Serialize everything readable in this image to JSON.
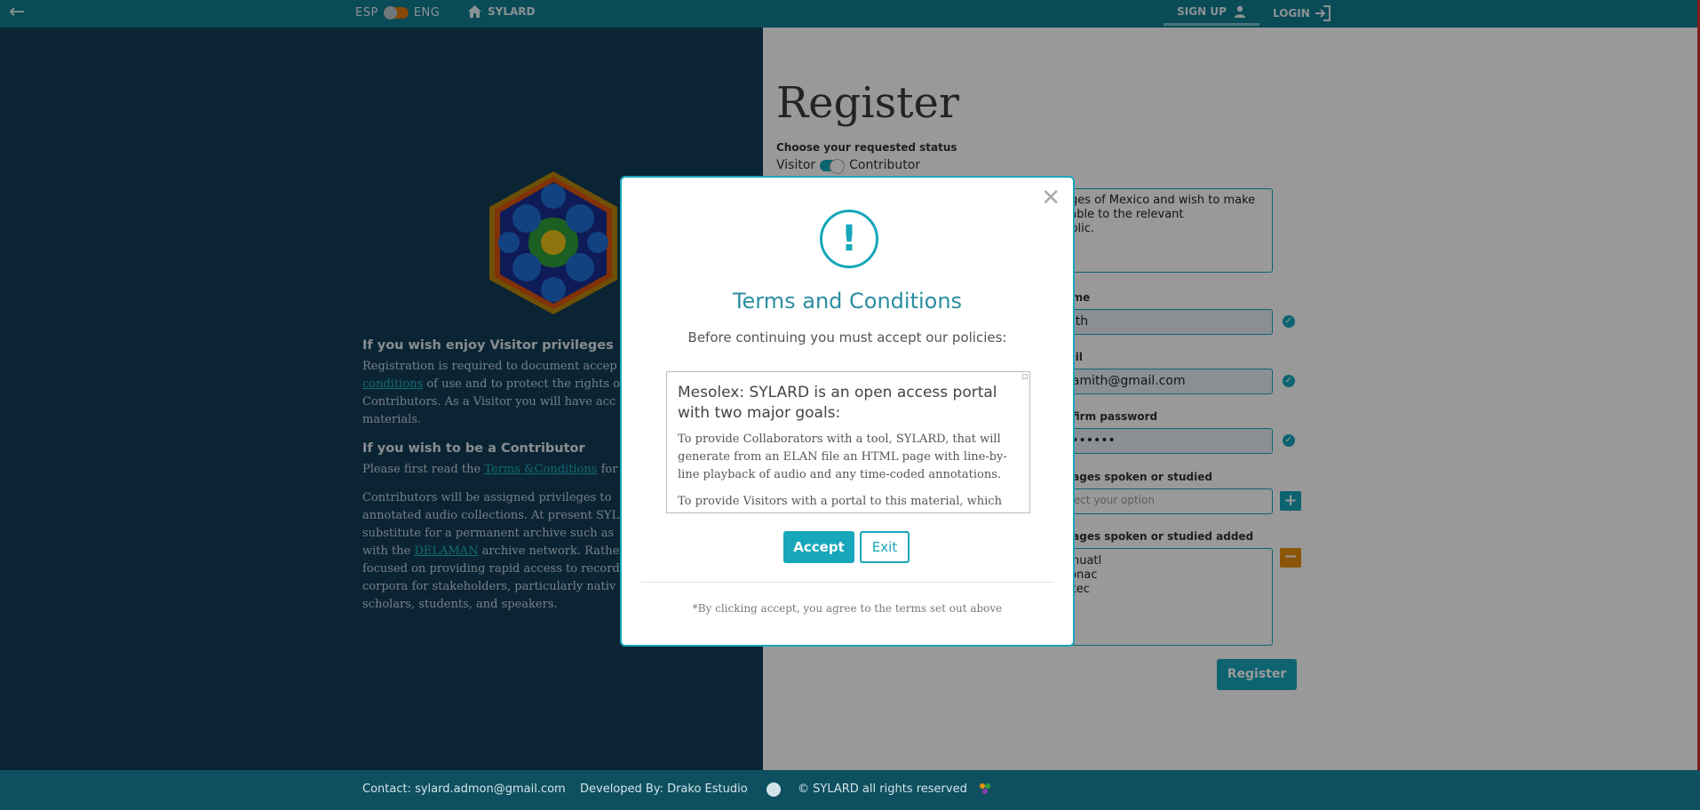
{
  "topbar": {
    "back_icon": "arrow-left-icon",
    "lang_left": "ESP",
    "lang_right": "ENG",
    "home_label": "SYLARD",
    "signup_label": "SIGN UP",
    "login_label": "LOGIN"
  },
  "left": {
    "visitor_heading": "If you wish enjoy Visitor privileges",
    "visitor_line1": "Registration is required to document accep",
    "visitor_link": "conditions",
    "visitor_line2_rest": " of use and to protect the rights o",
    "visitor_line3": "Contributors. As a Visitor you will have acc",
    "visitor_line4": "materials.",
    "contrib_heading": "If you wish to be a Contributor",
    "contrib_line1_pre": "Please first read the ",
    "contrib_link": "Terms &Conditions",
    "contrib_line1_post": " for",
    "para_line1": "Contributors will be assigned privileges to",
    "para_line2": "annotated audio collections. At present SYL",
    "para_line3": "substitute for a permanent archive such as",
    "para_line4_pre": "with the ",
    "para_line4_link": "DELAMAN",
    "para_line4_post": " archive network. Rather",
    "para_line5": "focused on providing rapid access to record",
    "para_line6": "corpora for stakeholders, particularly nativ",
    "para_line7": "scholars, students, and speakers."
  },
  "form": {
    "title": "Register",
    "status_label": "Choose your requested status",
    "status_left": "Visitor",
    "status_right": "Contributor",
    "textarea_lines": [
      "ages of Mexico and wish to make",
      "ilable to the relevant",
      "ublic."
    ],
    "name_label": " name",
    "name_value": "nith",
    "email_label": "mail",
    "email_value": "hamith@gmail.com",
    "password_label": "onfirm password",
    "password_value": "•••••••",
    "languages_label": "guages spoken or studied",
    "languages_placeholder": "elect your option",
    "languages_added_label": "guages spoken or studied added",
    "languages_added": [
      "ahuatl",
      "tonac",
      "xtec"
    ],
    "register_label": "Register"
  },
  "modal": {
    "close_icon": "close-icon",
    "alert_icon": "!",
    "title": "Terms and Conditions",
    "subtitle": "Before continuing you must accept our policies:",
    "policy_heading": "Mesolex: SYLARD is an open access portal with two major goals:",
    "policy_p1": "To provide Collaborators with a tool, SYLARD, that will generate from an ELAN file an HTML page with line-by-line playback of audio and any time-coded annotations.",
    "policy_p2": "To provide Visitors with a portal to this material, which",
    "accept_label": "Accept",
    "exit_label": "Exit",
    "footnote": "*By clicking accept, you agree to the terms set out above"
  },
  "footer": {
    "contact": "Contact: sylard.admon@gmail.com",
    "developed": "Developed By: Drako Estudio",
    "rights": "© SYLARD all rights reserved"
  },
  "colors": {
    "topbar": "#0f7d90",
    "left_panel": "#123d56",
    "accent": "#17a7bb",
    "warning": "#e8900c",
    "footer": "#0f5060"
  }
}
